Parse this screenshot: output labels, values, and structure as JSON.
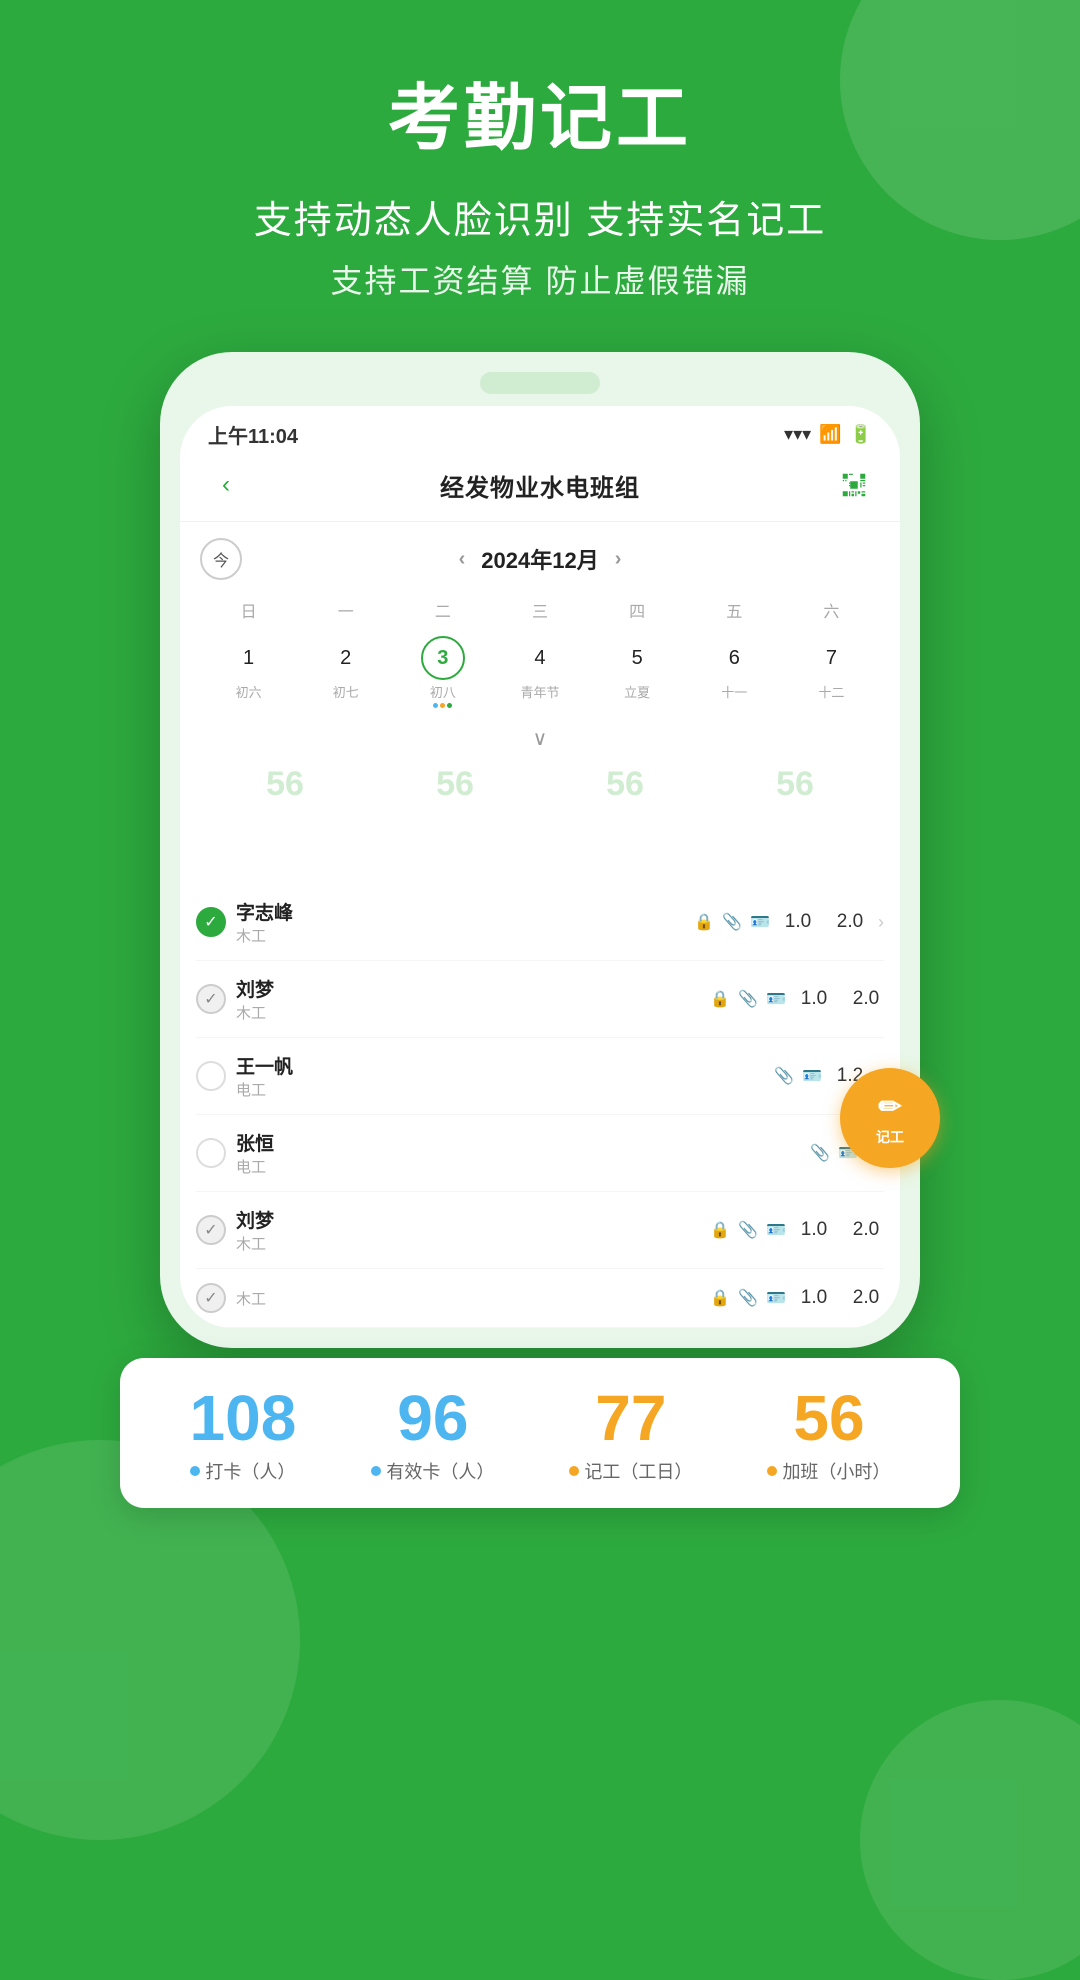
{
  "app": {
    "background_color": "#2daa3e"
  },
  "header": {
    "title": "考勤记工",
    "subtitle1": "支持动态人脸识别  支持实名记工",
    "subtitle2": "支持工资结算  防止虚假错漏"
  },
  "phone": {
    "status_bar": {
      "time": "上午11:04",
      "signal": "WiFi",
      "battery": "🔋"
    },
    "nav": {
      "back": "‹",
      "title": "经发物业水电班组"
    },
    "calendar": {
      "today_label": "今",
      "month": "2024年12月",
      "weekdays": [
        "日",
        "一",
        "二",
        "三",
        "四",
        "五",
        "六"
      ],
      "days": [
        {
          "num": "1",
          "lunar": "初六",
          "dots": []
        },
        {
          "num": "2",
          "lunar": "初七",
          "dots": []
        },
        {
          "num": "3",
          "lunar": "初八",
          "today": true,
          "dots": [
            "blue",
            "orange",
            "green"
          ]
        },
        {
          "num": "4",
          "lunar": "青年节",
          "dots": []
        },
        {
          "num": "5",
          "lunar": "立夏",
          "dots": []
        },
        {
          "num": "6",
          "lunar": "十一",
          "dots": []
        },
        {
          "num": "7",
          "lunar": "十二",
          "dots": []
        }
      ]
    },
    "stats_bg": {
      "numbers": [
        "56",
        "56",
        "56",
        "56"
      ]
    }
  },
  "stats_card": {
    "items": [
      {
        "number": "108",
        "color": "blue",
        "dot_color": "blue",
        "label": "打卡（人）"
      },
      {
        "number": "96",
        "color": "blue",
        "dot_color": "blue",
        "label": "有效卡（人）"
      },
      {
        "number": "77",
        "color": "orange",
        "dot_color": "orange",
        "label": "记工（工日）"
      },
      {
        "number": "56",
        "color": "orange",
        "dot_color": "orange",
        "label": "加班（小时）"
      }
    ]
  },
  "workers": [
    {
      "name": "字志峰",
      "type": "木工",
      "checked": true,
      "hours": "1.0",
      "overtime": "2.0",
      "has_arrow": true
    },
    {
      "name": "刘梦",
      "type": "木工",
      "checked": "half",
      "hours": "1.0",
      "overtime": "2.0",
      "has_arrow": false
    },
    {
      "name": "王一帆",
      "type": "电工",
      "checked": false,
      "hours": "1.2",
      "overtime": "",
      "has_arrow": true
    },
    {
      "name": "张恒",
      "type": "电工",
      "checked": false,
      "hours": "",
      "overtime": "",
      "has_arrow": true
    },
    {
      "name": "刘梦",
      "type": "木工",
      "checked": "half",
      "hours": "1.0",
      "overtime": "2.0",
      "has_arrow": false
    },
    {
      "name": "",
      "type": "木工",
      "checked": "half",
      "hours": "1.0",
      "overtime": "2.0",
      "has_arrow": false
    }
  ],
  "fab": {
    "icon": "✏",
    "label": "记工"
  },
  "dot_colors": {
    "blue": "#4db6f0",
    "orange": "#f5a623",
    "green": "#2daa3e"
  }
}
